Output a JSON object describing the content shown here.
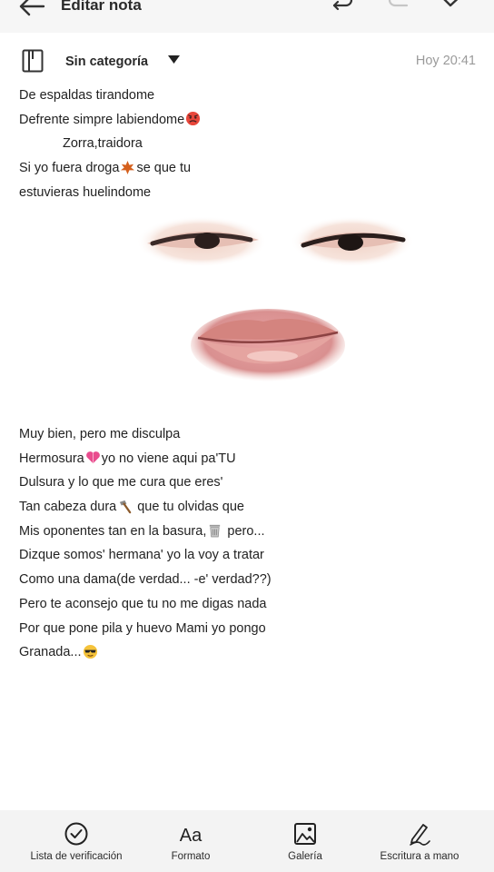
{
  "header": {
    "title": "Editar nota",
    "icons": [
      "back-arrow-icon",
      "undo-icon",
      "redo-icon",
      "check-icon"
    ]
  },
  "category": {
    "label": "Sin categoría",
    "time": "Hoy 20:41"
  },
  "note": {
    "stanza1": [
      {
        "text": "De espaldas tirandome"
      },
      {
        "text": "Defrente simpre labiendome",
        "emoji": "angry-face-emoji"
      },
      {
        "text": "Zorra,traidora"
      },
      {
        "text": "Si yo fuera droga",
        "emoji": "leaf-emoji",
        "after": "se que tu"
      },
      {
        "text": "estuvieras huelindome"
      }
    ],
    "stanza2": [
      {
        "text": "Muy bien, pero me disculpa"
      },
      {
        "text": "Hermosura",
        "emoji": "heart-emoji",
        "after": "yo no viene aqui pa'TU"
      },
      {
        "text": "Dulsura y lo que me cura que eres'"
      },
      {
        "text": "Tan cabeza dura",
        "emoji": "hammer-emoji",
        "after": " que tu olvidas que"
      },
      {
        "text": "Mis oponentes tan en la basura,",
        "emoji": "trash-can-emoji",
        "after": " pero..."
      },
      {
        "text": "Dizque somos' hermana' yo la voy a tratar"
      },
      {
        "text": "Como una dama(de verdad... -e' verdad??)"
      },
      {
        "text": "Pero te aconsejo que tu no me digas nada"
      },
      {
        "text": "Por que pone pila y huevo Mami yo pongo"
      },
      {
        "text": "Granada...",
        "emoji": "sunglasses-emoji"
      }
    ]
  },
  "toolbar": {
    "checklist": "Lista de verificación",
    "format": "Formato",
    "format_glyph": "Aa",
    "gallery": "Galería",
    "handwriting": "Escritura a mano"
  }
}
